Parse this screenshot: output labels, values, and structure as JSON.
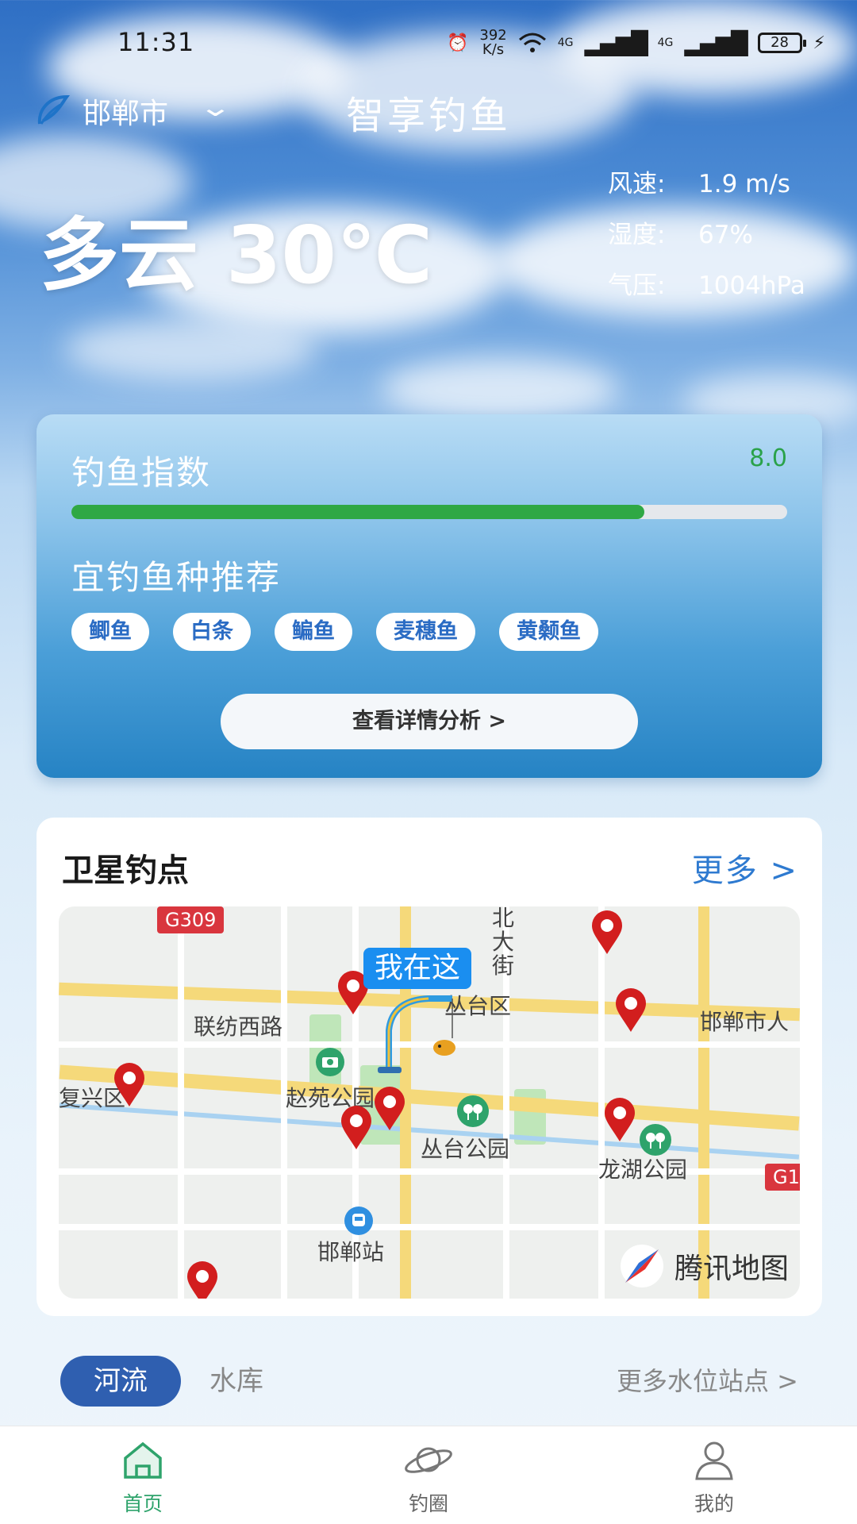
{
  "status_bar": {
    "time": "11:31",
    "net_speed_value": "392",
    "net_speed_unit": "K/s",
    "signal_1": "4G",
    "signal_2": "4G",
    "battery": "28"
  },
  "header": {
    "city": "邯郸市",
    "app_title": "智享钓鱼"
  },
  "weather": {
    "summary": "多云 30℃",
    "stats": [
      {
        "label": "风速:",
        "value": "1.9 m/s"
      },
      {
        "label": "湿度:",
        "value": "67%"
      },
      {
        "label": "气压:",
        "value": "1004hPa"
      }
    ]
  },
  "fishing_index": {
    "title": "钓鱼指数",
    "score": "8.0",
    "score_fraction": 0.8,
    "recommend_title": "宜钓鱼种推荐",
    "fish": [
      "鲫鱼",
      "白条",
      "鳊鱼",
      "麦穗鱼",
      "黄颡鱼"
    ],
    "detail_button": "查看详情分析 >"
  },
  "spots": {
    "title": "卫星钓点",
    "more": "更多 >",
    "map": {
      "here_label": "我在这",
      "labels": [
        "联纺西路",
        "赵苑公园",
        "丛台公园",
        "龙湖公园",
        "邯郸站",
        "复兴区",
        "丛台区",
        "邯郸市人",
        "北大街"
      ],
      "route_badges": [
        "G309",
        "G1"
      ],
      "provider": "腾讯地图"
    }
  },
  "water_level": {
    "tab_river": "河流",
    "tab_reservoir": "水库",
    "more": "更多水位站点 >"
  },
  "bottom_nav": {
    "items": [
      {
        "label": "首页",
        "icon": "home-icon",
        "active": true
      },
      {
        "label": "钓圈",
        "icon": "planet-icon",
        "active": false
      },
      {
        "label": "我的",
        "icon": "user-icon",
        "active": false
      }
    ]
  },
  "colors": {
    "accent_green": "#2fa844",
    "accent_blue": "#2e7ad0",
    "active_nav": "#2ea36b",
    "pin_red": "#d21e1e"
  }
}
